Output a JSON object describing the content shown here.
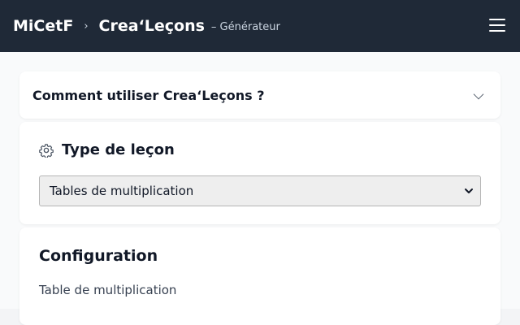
{
  "header": {
    "brand": "MiCetF",
    "separator": "›",
    "app_name": "Crea‘Leçons",
    "app_subtitle": "– Générateur",
    "menu_icon": "hamburger-menu-icon"
  },
  "help": {
    "title": "Comment utiliser Crea‘Leçons ?",
    "toggle_icon": "chevron-down-icon"
  },
  "lesson_type": {
    "title": "Type de leçon",
    "icon": "gear-icon",
    "selected": "Tables de multiplication"
  },
  "configuration": {
    "title": "Configuration",
    "field_label": "Table de multiplication"
  },
  "colors": {
    "header_bg": "#1f2937",
    "card_bg": "#ffffff",
    "page_bg": "#f9fafb"
  }
}
